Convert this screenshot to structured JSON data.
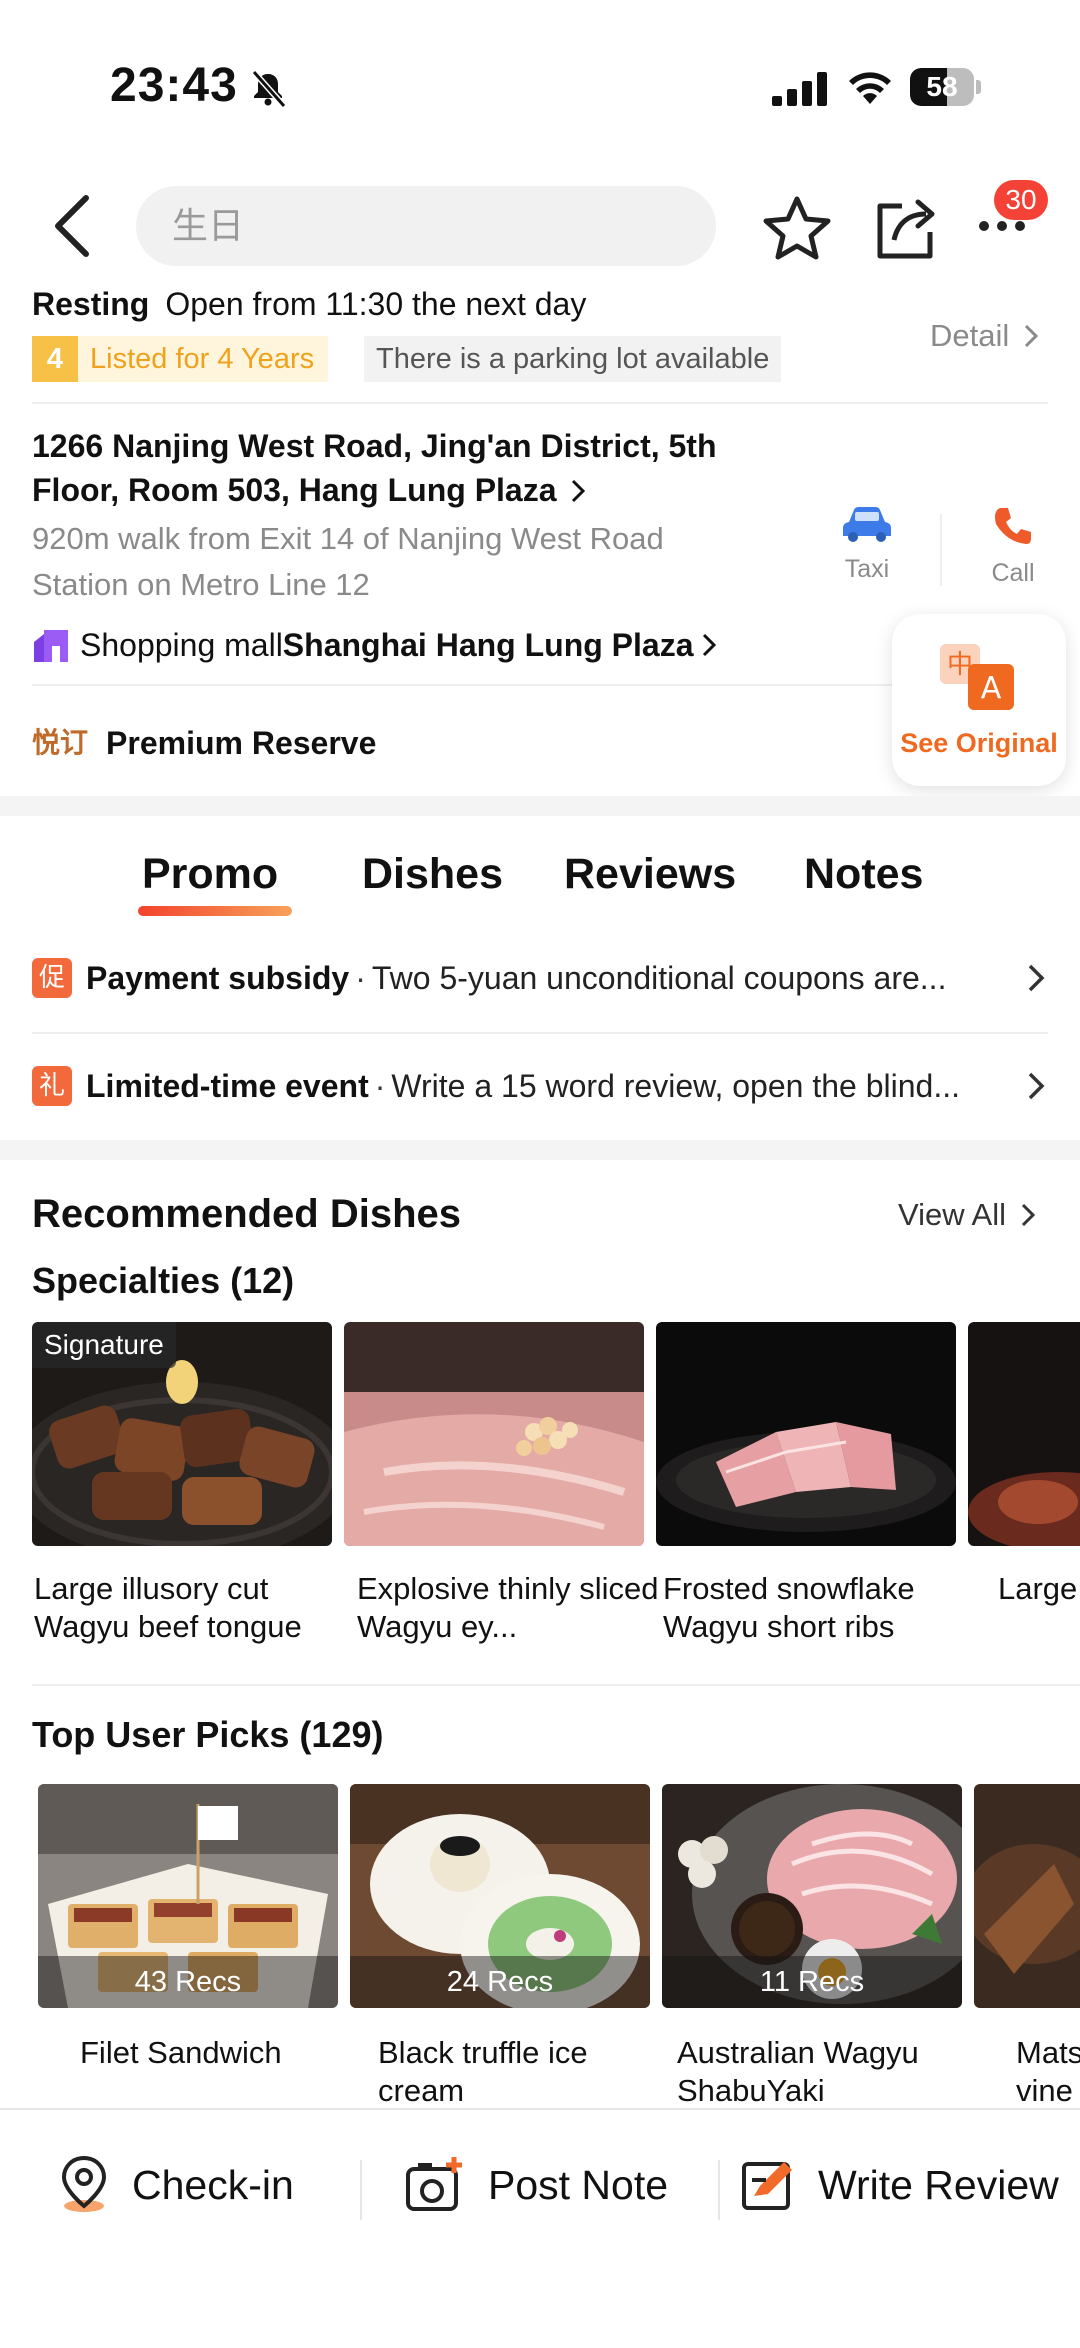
{
  "status_bar": {
    "time": "23:43",
    "battery": "58",
    "battery_level": 0.58
  },
  "header": {
    "search_placeholder": "生日",
    "notification_badge": "30"
  },
  "info": {
    "status": "Resting",
    "hours": "Open from 11:30 the next day",
    "years_num": "4",
    "years_tag": "Listed for 4 Years",
    "parking_tag": "There is a parking lot available",
    "detail_label": "Detail",
    "address": "1266 Nanjing West Road, Jing'an District, 5th Floor, Room 503, Hang Lung Plaza",
    "walk": "920m walk from Exit 14 of Nanjing West Road Station on Metro Line 12",
    "taxi_label": "Taxi",
    "call_label": "Call",
    "mall_prefix": "Shopping mall",
    "mall_name": "Shanghai Hang Lung Plaza",
    "premium_icon": "悦订",
    "premium_label": "Premium Reserve",
    "see_original_label": "See Original"
  },
  "tabs": [
    {
      "label": "Promo",
      "active": true
    },
    {
      "label": "Dishes"
    },
    {
      "label": "Reviews"
    },
    {
      "label": "Notes"
    }
  ],
  "promos": [
    {
      "icon": "促",
      "title": "Payment subsidy",
      "sep": "·",
      "desc": "Two 5-yuan unconditional coupons are..."
    },
    {
      "icon": "礼",
      "title": "Limited-time event",
      "sep": "·",
      "desc": "Write a 15 word review, open the blind..."
    }
  ],
  "recommended": {
    "title": "Recommended Dishes",
    "view_all": "View All",
    "specialties_title": "Specialties (12)",
    "signature_tag": "Signature",
    "specialties": [
      {
        "name": "Large illusory cut Wagyu beef tongue"
      },
      {
        "name": "Explosive thinly sliced Wagyu ey..."
      },
      {
        "name": "Frosted snowflake Wagyu short ribs"
      },
      {
        "name": "Large"
      }
    ],
    "top_picks_title": "Top User Picks (129)",
    "top_picks": [
      {
        "name": "Filet Sandwich",
        "recs": "43 Recs"
      },
      {
        "name": "Black truffle ice cream",
        "recs": "24 Recs"
      },
      {
        "name": "Australian Wagyu ShabuYaki",
        "recs": "11 Recs"
      },
      {
        "name": "Mats vine"
      }
    ]
  },
  "bottom_bar": {
    "checkin_label": "Check-in",
    "post_note_label": "Post Note",
    "write_review_label": "Write Review"
  }
}
